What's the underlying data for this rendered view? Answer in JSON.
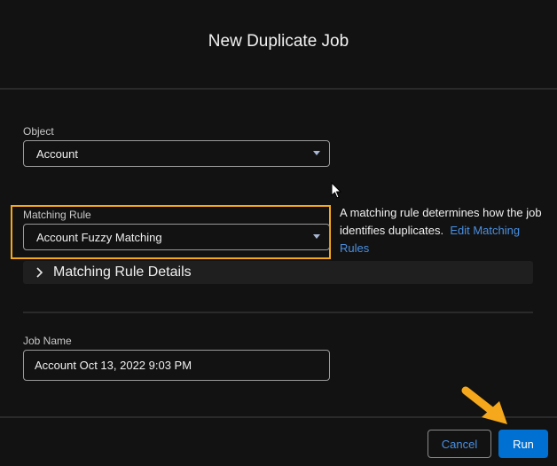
{
  "dialog": {
    "title": "New Duplicate Job"
  },
  "object": {
    "label": "Object",
    "value": "Account"
  },
  "matching_rule": {
    "label": "Matching Rule",
    "value": "Account Fuzzy Matching",
    "help_text": "A matching rule determines how the job identifies duplicates.",
    "help_link": "Edit Matching Rules"
  },
  "details": {
    "label": "Matching Rule Details"
  },
  "job_name": {
    "label": "Job Name",
    "value": "Account Oct 13, 2022 9:03 PM"
  },
  "footer": {
    "cancel": "Cancel",
    "run": "Run"
  },
  "colors": {
    "highlight": "#f5a81c",
    "primary": "#0070d2",
    "link": "#4a90e2"
  }
}
